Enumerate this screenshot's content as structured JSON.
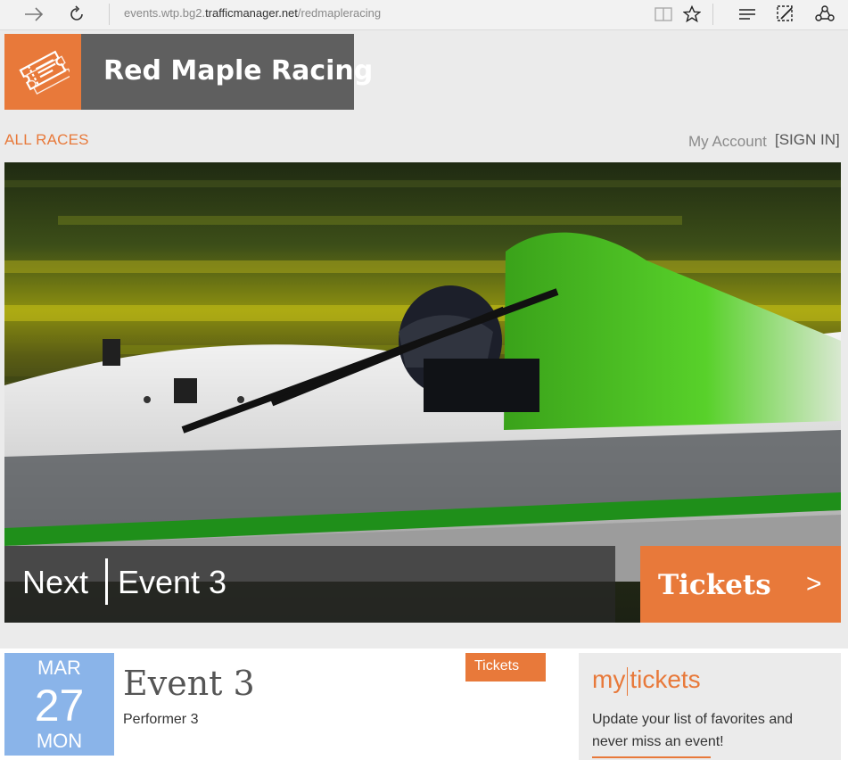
{
  "browser": {
    "url_prefix": "events.wtp.bg2.",
    "url_domain": "trafficmanager.net",
    "url_path": "/redmapleracing",
    "icons": [
      "forward-icon",
      "refresh-icon",
      "reading-view-icon",
      "favorite-star-icon",
      "hub-icon",
      "web-note-icon",
      "share-icon"
    ]
  },
  "header": {
    "brand": "Red Maple Racing",
    "logo_icon": "ticket-icon",
    "accent_color": "#e8793a",
    "brand_bg": "#5f5f5f"
  },
  "nav": {
    "all_races": "ALL RACES",
    "my_account": "My Account",
    "sign_in": "[SIGN IN]"
  },
  "hero": {
    "next_label": "Next",
    "event_name": "Event 3",
    "tickets_label": "Tickets",
    "tickets_arrow": ">"
  },
  "event": {
    "month": "MAR",
    "day": "27",
    "weekday": "MON",
    "title": "Event 3",
    "performer": "Performer 3",
    "tickets_label": "Tickets",
    "date_tile_color": "#8ab4e9"
  },
  "mytickets": {
    "title_part1": "my",
    "title_part2": "tickets",
    "description": "Update your list of favorites and never miss an event!"
  }
}
